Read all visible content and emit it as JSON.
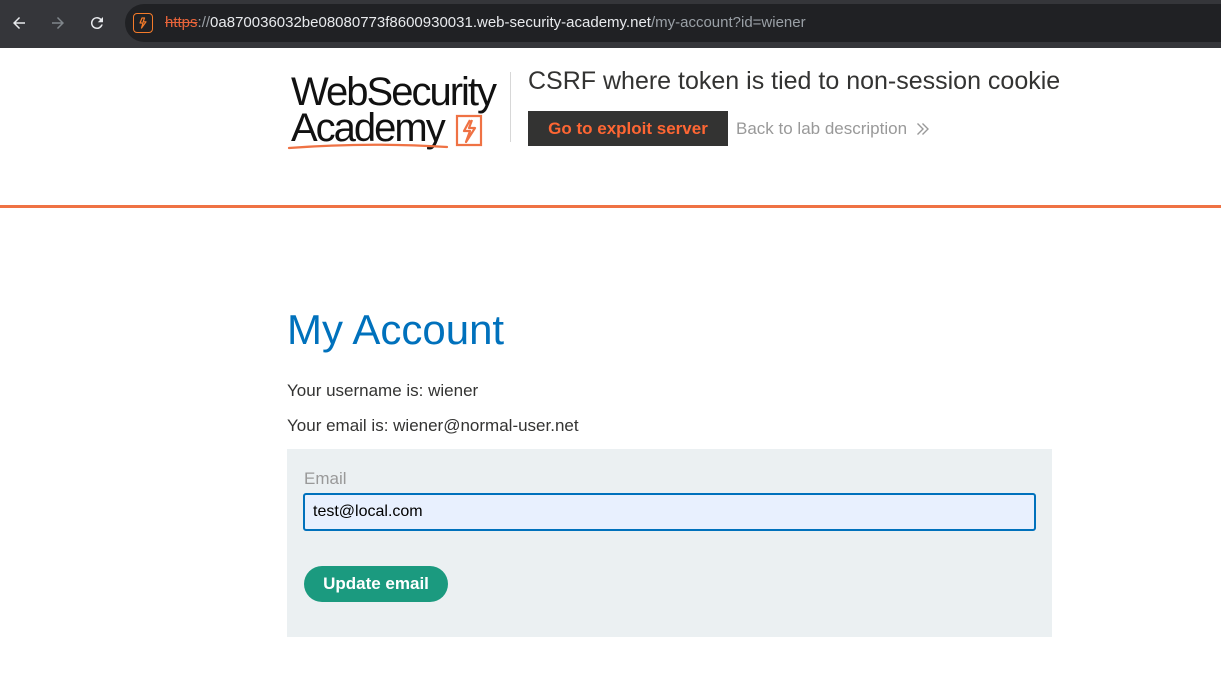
{
  "browser": {
    "url_scheme": "https",
    "url_separator": "://",
    "url_host": "0a870036032be08080773f8600930031.web-security-academy.net",
    "url_path": "/my-account?id=wiener",
    "icons": [
      "back-arrow-icon",
      "forward-arrow-icon",
      "reload-icon",
      "site-lightning-icon"
    ]
  },
  "header": {
    "logo_line1": "WebSecurity",
    "logo_line2": "Academy",
    "lab_title": "CSRF where token is tied to non-session cookie",
    "exploit_button": "Go to exploit server",
    "back_link": "Back to lab description"
  },
  "main": {
    "title": "My Account",
    "username_line": "Your username is: wiener",
    "email_line": "Your email is: wiener@normal-user.net",
    "form": {
      "email_label": "Email",
      "email_value": "test@local.com",
      "submit_label": "Update email"
    }
  },
  "colors": {
    "accent_orange": "#ef7244",
    "title_blue": "#0071bc",
    "button_green": "#1b9a7f",
    "panel_bg": "#ebf0f2"
  }
}
